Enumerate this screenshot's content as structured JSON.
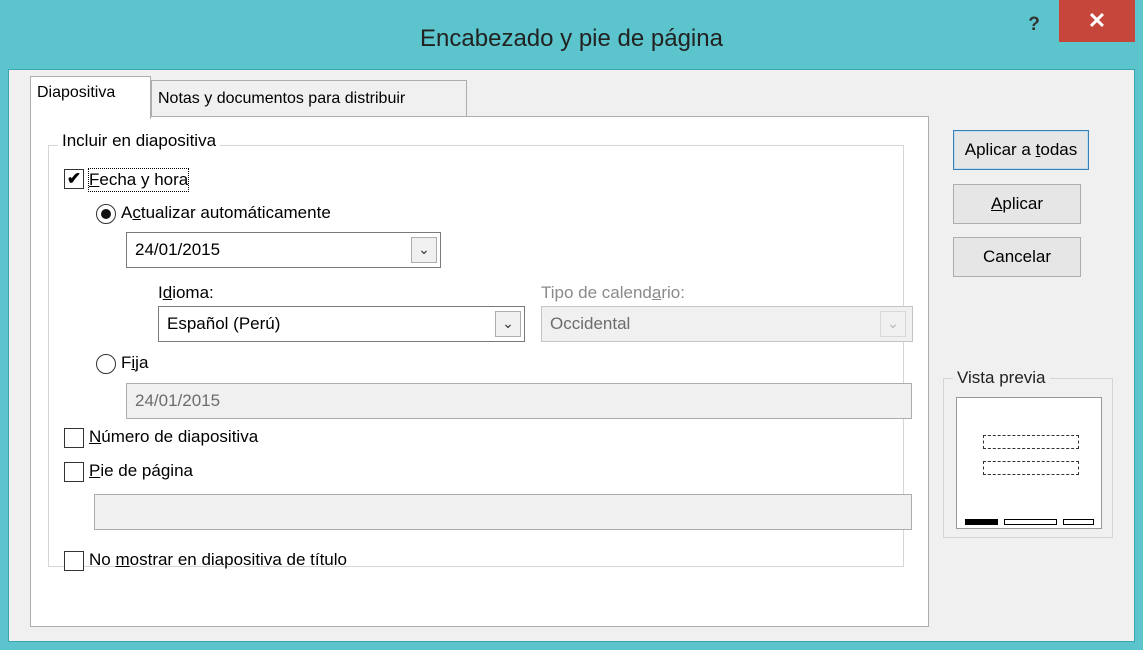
{
  "window": {
    "title": "Encabezado y pie de página",
    "help_label": "?",
    "close_label": "✕"
  },
  "tabs": [
    {
      "label": "Diapositiva",
      "active": true
    },
    {
      "label": "Notas y documentos para distribuir",
      "active": false
    }
  ],
  "include_group": {
    "label": "Incluir en diapositiva",
    "date_time": {
      "checked": true,
      "label_u": "F",
      "label_rest": "echa y hora",
      "auto_update": {
        "selected": true,
        "label_pre": "A",
        "label_u": "c",
        "label_rest": "tualizar automáticamente",
        "date_value": "24/01/2015"
      },
      "language": {
        "label_pre": "I",
        "label_u": "d",
        "label_rest": "ioma:",
        "value": "Español (Perú)"
      },
      "calendar": {
        "label_pre": "Tipo de calend",
        "label_u": "a",
        "label_rest": "rio:",
        "value": "Occidental",
        "enabled": false
      },
      "fixed": {
        "selected": false,
        "label_pre": "F",
        "label_u": "i",
        "label_rest": "ja",
        "value": "24/01/2015"
      }
    },
    "slide_number": {
      "checked": false,
      "label_u": "N",
      "label_rest": "úmero de diapositiva"
    },
    "footer": {
      "checked": false,
      "label_u": "P",
      "label_rest": "ie de página",
      "value": ""
    }
  },
  "dont_show_title": {
    "checked": false,
    "label_pre": "No ",
    "label_u": "m",
    "label_rest": "ostrar en diapositiva de título"
  },
  "buttons": {
    "apply_all": {
      "pre": "Aplicar a ",
      "u": "t",
      "rest": "odas"
    },
    "apply": {
      "pre": "",
      "u": "A",
      "rest": "plicar"
    },
    "cancel": {
      "label": "Cancelar"
    }
  },
  "preview": {
    "label": "Vista previa"
  },
  "icons": {
    "check": "✔",
    "chevron": "⌄"
  },
  "colors": {
    "titlebar": "#5bc4cc",
    "close": "#c7463b",
    "default_button_border": "#3c7fb1"
  }
}
